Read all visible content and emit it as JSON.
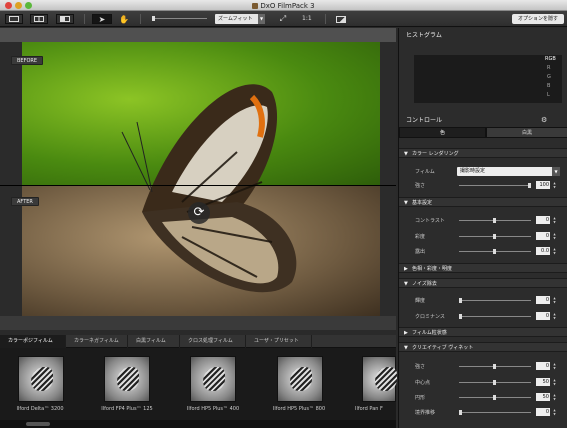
{
  "window": {
    "title": "DxO FilmPack 3"
  },
  "toolbar": {
    "zoom_label": "ズームフィット",
    "ratio_label": "1:1",
    "options_label": "オプションを隠す"
  },
  "canvas": {
    "before_label": "BEFORE",
    "after_label": "AFTER"
  },
  "film_tabs": [
    {
      "label": "カラーポジフィルム"
    },
    {
      "label": "カラーネガフィルム"
    },
    {
      "label": "白黒フィルム"
    },
    {
      "label": "クロス処理フィルム"
    },
    {
      "label": "ユーザ・プリセット"
    }
  ],
  "films": [
    {
      "label": "Ilford Delta™ 3200"
    },
    {
      "label": "Ilford FP4 Plus™ 125"
    },
    {
      "label": "Ilford HP5 Plus™ 400"
    },
    {
      "label": "Ilford HP5 Plus™ 800"
    },
    {
      "label": "Ilford Pan F"
    }
  ],
  "panel": {
    "histogram_title": "ヒストグラム",
    "hist_channels": [
      "RGB",
      "R",
      "G",
      "B",
      "L"
    ],
    "control_title": "コントロール",
    "tab_color": "色",
    "tab_bw": "白黒",
    "sections": {
      "color_rendering": "カラー レンダリング",
      "basic": "基本設定",
      "hsl": "色相・彩度・明度",
      "noise": "ノイズ除去",
      "grain": "フィルム粒状感",
      "vignette": "クリエイティブ ヴィネット"
    },
    "film_label": "フィルム",
    "film_value": "撮影時設定",
    "strength_label": "強さ",
    "strength_value": "100",
    "contrast_label": "コントラスト",
    "contrast_value": "0",
    "saturation_label": "彩度",
    "saturation_value": "0",
    "exposure_label": "露出",
    "exposure_value": "0.0",
    "luminance_label": "輝度",
    "luminance_value": "0",
    "chrominance_label": "クロミナンス",
    "chrominance_value": "0",
    "vig_strength_label": "強さ",
    "vig_strength_value": "0",
    "vig_center_label": "中心点",
    "vig_center_value": "50",
    "vig_roundness_label": "円形",
    "vig_roundness_value": "50",
    "vig_transition_label": "境界推移",
    "vig_transition_value": "0"
  },
  "colors": {
    "accent": "#1a1a1a",
    "before_bg": "#6fae18",
    "after_bg": "#8a7555"
  }
}
